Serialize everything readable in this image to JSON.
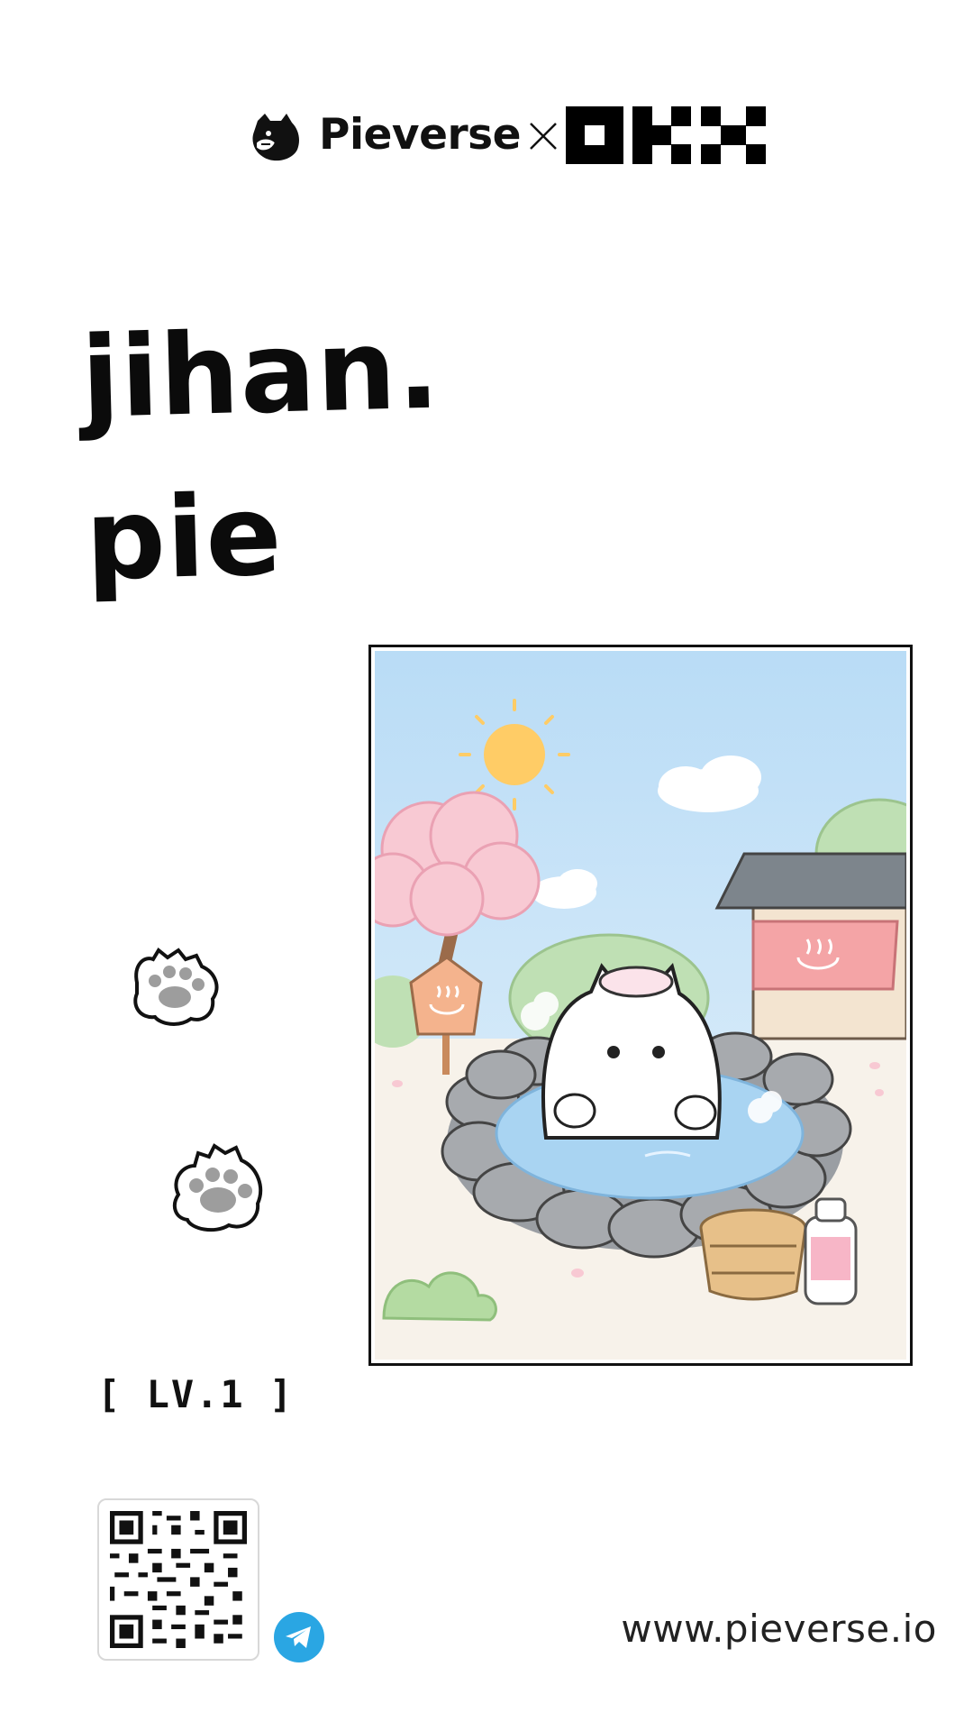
{
  "header": {
    "brand_name": "Pieverse",
    "separator": "×",
    "partner_logo": "OKX"
  },
  "handle": {
    "line1": "jihan.",
    "line2": "pie"
  },
  "artwork": {
    "description_icon": "cat-in-hot-spring-illustration"
  },
  "level": "[ LV.1 ]",
  "footer": {
    "url": "www.pieverse.io",
    "telegram_icon": "telegram-icon",
    "qr_icon": "qr-code"
  },
  "colors": {
    "telegram": "#2aa6e3",
    "sky": "#cfe6f7",
    "sun": "#ffcc66",
    "blossom": "#f8c9d3",
    "noren": "#f4a4a6"
  }
}
